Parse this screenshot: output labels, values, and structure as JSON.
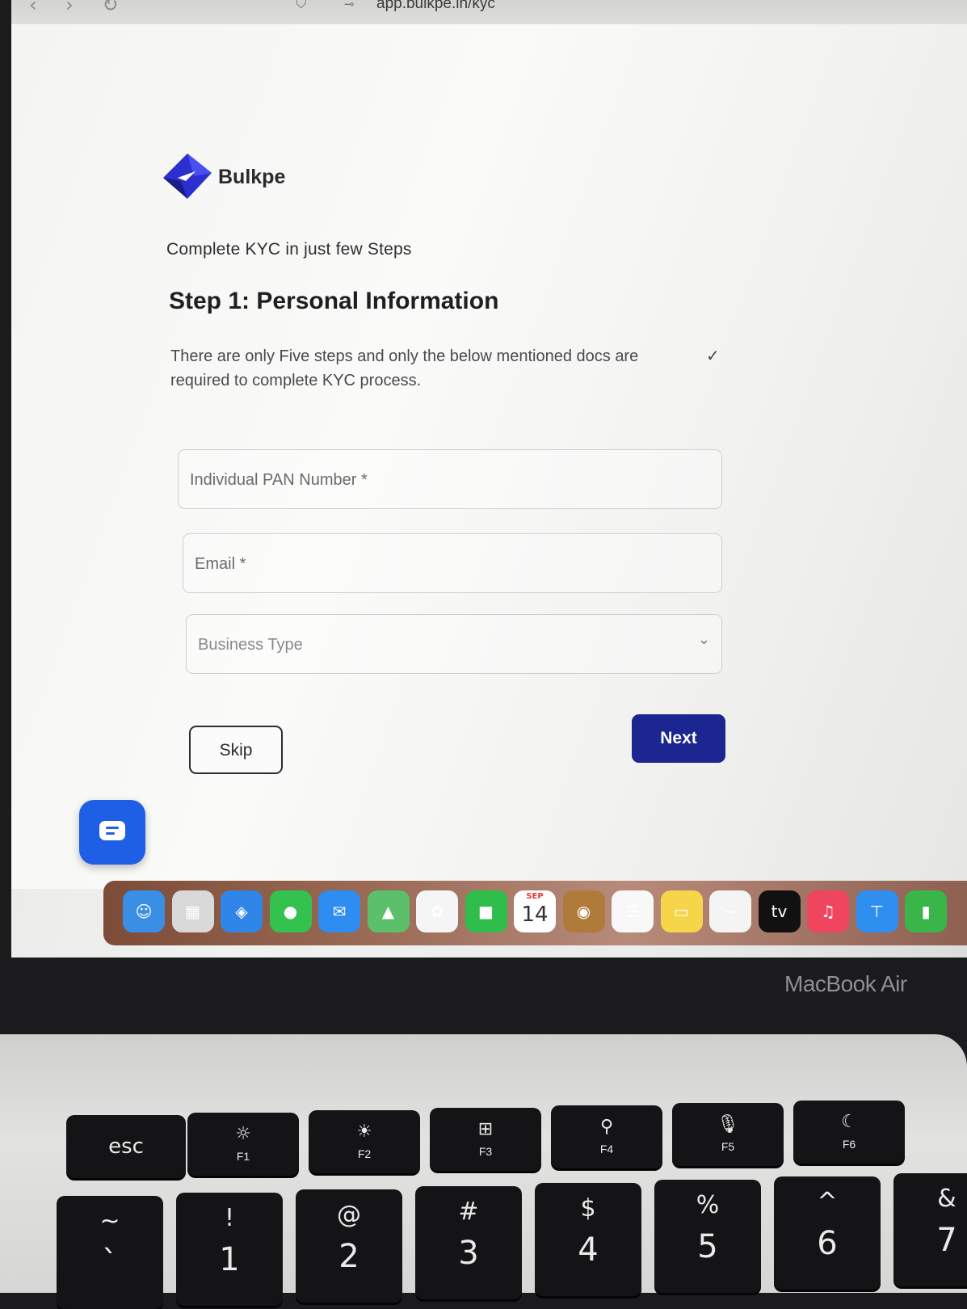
{
  "browser": {
    "url": "app.bulkpe.in/kyc",
    "nav_icons": "‹ › ↻",
    "bookmark_icon": "⛉",
    "site_icon": "⊸"
  },
  "brand": {
    "name": "Bulkpe",
    "color": "#1b2691"
  },
  "kyc": {
    "tagline": "Complete KYC in just few Steps",
    "step_title": "Step 1: Personal Information",
    "description": "There are only Five steps and only the below mentioned docs are required to complete KYC process.",
    "description_chevron": "✓",
    "fields": {
      "pan_placeholder": "Individual PAN Number *",
      "email_placeholder": "Email *",
      "business_type_placeholder": "Business Type",
      "business_type_chevron": "⌄"
    },
    "buttons": {
      "skip": "Skip",
      "next": "Next"
    }
  },
  "dock": {
    "items": [
      {
        "name": "finder-icon",
        "glyph": "☺",
        "bg": "#3a8ee6"
      },
      {
        "name": "launchpad-icon",
        "glyph": "▦",
        "bg": "#d9d9d9"
      },
      {
        "name": "safari-icon",
        "glyph": "◈",
        "bg": "#2f86e8"
      },
      {
        "name": "messages-icon",
        "glyph": "●",
        "bg": "#33c24d"
      },
      {
        "name": "mail-icon",
        "glyph": "✉",
        "bg": "#2e8df0"
      },
      {
        "name": "maps-icon",
        "glyph": "▲",
        "bg": "#5cbf6a"
      },
      {
        "name": "photos-icon",
        "glyph": "✿",
        "bg": "#f5f5f5"
      },
      {
        "name": "facetime-icon",
        "glyph": "■",
        "bg": "#2fbe4b"
      },
      {
        "name": "calendar-icon",
        "glyph": "",
        "bg": "#ffffff",
        "month": "SEP",
        "day": "14"
      },
      {
        "name": "contacts-icon",
        "glyph": "◉",
        "bg": "#b07a3a"
      },
      {
        "name": "reminders-icon",
        "glyph": "☰",
        "bg": "#f8f8f8"
      },
      {
        "name": "notes-icon",
        "glyph": "▭",
        "bg": "#f6d54a"
      },
      {
        "name": "freeform-icon",
        "glyph": "~",
        "bg": "#f4f4f4"
      },
      {
        "name": "apple-tv-icon",
        "glyph": "tv",
        "bg": "#111111"
      },
      {
        "name": "music-icon",
        "glyph": "♫",
        "bg": "#f0455e"
      },
      {
        "name": "keynote-icon",
        "glyph": "⊤",
        "bg": "#2f8ff0"
      },
      {
        "name": "numbers-icon",
        "glyph": "▮",
        "bg": "#39b54a"
      }
    ]
  },
  "device_label": "MacBook Air",
  "keyboard": {
    "function_row": [
      {
        "id": "esc",
        "label": "esc",
        "icon": ""
      },
      {
        "id": "f1",
        "label": "F1",
        "icon": "☼"
      },
      {
        "id": "f2",
        "label": "F2",
        "icon": "☀"
      },
      {
        "id": "f3",
        "label": "F3",
        "icon": "⊞"
      },
      {
        "id": "f4",
        "label": "F4",
        "icon": "⚲"
      },
      {
        "id": "f5",
        "label": "F5",
        "icon": "🎙"
      },
      {
        "id": "f6",
        "label": "F6",
        "icon": "☾"
      }
    ],
    "number_row": [
      {
        "top": "~",
        "bottom": "`"
      },
      {
        "top": "!",
        "bottom": "1"
      },
      {
        "top": "@",
        "bottom": "2"
      },
      {
        "top": "#",
        "bottom": "3"
      },
      {
        "top": "$",
        "bottom": "4"
      },
      {
        "top": "%",
        "bottom": "5"
      },
      {
        "top": "^",
        "bottom": "6"
      },
      {
        "top": "&",
        "bottom": "7"
      }
    ]
  }
}
